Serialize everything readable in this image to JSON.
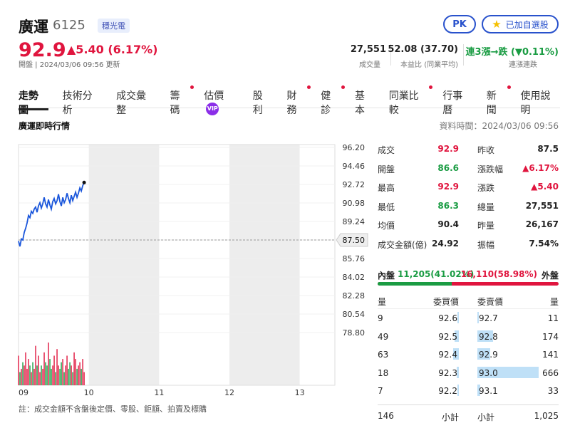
{
  "header": {
    "name": "廣運",
    "code": "6125",
    "tag": "穩光電",
    "pk_label": "PK",
    "fav_label": "已加自選股",
    "price": "92.9",
    "change": "▲5.40 (6.17%)",
    "status": "開盤 | 2024/03/06 09:56 更新"
  },
  "summary": [
    {
      "value": "27,551",
      "label": "成交量"
    },
    {
      "value": "52.08 (37.70)",
      "label": "本益比 (同業平均)"
    },
    {
      "value": "連3漲→跌 (▼0.11%)",
      "label": "連漲連跌"
    }
  ],
  "tabs": [
    {
      "label": "走勢圖",
      "active": true,
      "dot": false,
      "vip": false
    },
    {
      "label": "技術分析",
      "active": false,
      "dot": false,
      "vip": false
    },
    {
      "label": "成交彙整",
      "active": false,
      "dot": false,
      "vip": false
    },
    {
      "label": "籌碼",
      "active": false,
      "dot": true,
      "vip": false
    },
    {
      "label": "估價",
      "active": false,
      "dot": false,
      "vip": true
    },
    {
      "label": "股利",
      "active": false,
      "dot": false,
      "vip": false
    },
    {
      "label": "財務",
      "active": false,
      "dot": true,
      "vip": false
    },
    {
      "label": "健診",
      "active": false,
      "dot": true,
      "vip": false
    },
    {
      "label": "基本",
      "active": false,
      "dot": false,
      "vip": false
    },
    {
      "label": "同業比較",
      "active": false,
      "dot": true,
      "vip": false
    },
    {
      "label": "行事曆",
      "active": false,
      "dot": false,
      "vip": false
    },
    {
      "label": "新聞",
      "active": false,
      "dot": true,
      "vip": false
    },
    {
      "label": "使用說明",
      "active": false,
      "dot": false,
      "vip": false
    }
  ],
  "section_title": "廣運即時行情",
  "data_time": "資料時間：2024/03/06 09:56",
  "vip_label": "VIP",
  "chart_data": {
    "type": "line",
    "x_ticks": [
      "09",
      "10",
      "11",
      "12",
      "13"
    ],
    "y_ticks": [
      "96.20",
      "94.46",
      "92.72",
      "90.98",
      "89.24",
      "87.50",
      "85.76",
      "84.02",
      "82.28",
      "80.54",
      "78.80"
    ],
    "ylim": [
      78.8,
      96.2
    ],
    "reference_price": "87.50",
    "series": [
      {
        "values": [
          87.4,
          86.9,
          87.6,
          87.5,
          88.2,
          88.6,
          89.1,
          89.8,
          89.6,
          90.2,
          90.0,
          90.4,
          90.6,
          90.1,
          90.7,
          91.0,
          90.5,
          90.9,
          91.5,
          90.9,
          90.6,
          91.3,
          90.8,
          90.4,
          91.1,
          91.4,
          90.9,
          91.2,
          91.8,
          91.1,
          90.7,
          91.5,
          91.0,
          91.3,
          91.9,
          91.4,
          91.0,
          91.7,
          91.2,
          91.6,
          92.0,
          91.5,
          91.9,
          92.4,
          92.1,
          92.6,
          92.9
        ]
      }
    ],
    "volume": [
      9,
      4,
      5,
      7,
      6,
      10,
      5,
      8,
      6,
      4,
      7,
      5,
      12,
      6,
      9,
      4,
      6,
      5,
      10,
      7,
      6,
      13,
      8,
      5,
      6,
      9,
      4,
      11,
      6,
      5,
      7,
      8,
      4,
      6,
      9,
      5,
      7,
      6,
      4,
      10,
      8,
      5,
      6,
      7,
      5,
      8,
      4
    ]
  },
  "quote_table": [
    {
      "l1": "成交",
      "v1": "92.9",
      "c1": "red",
      "l2": "昨收",
      "v2": "87.5",
      "c2": "dark"
    },
    {
      "l1": "開盤",
      "v1": "86.6",
      "c1": "green",
      "l2": "漲跌幅",
      "v2": "▲6.17%",
      "c2": "red"
    },
    {
      "l1": "最高",
      "v1": "92.9",
      "c1": "red",
      "l2": "漲跌",
      "v2": "▲5.40",
      "c2": "red"
    },
    {
      "l1": "最低",
      "v1": "86.3",
      "c1": "green",
      "l2": "總量",
      "v2": "27,551",
      "c2": "dark"
    },
    {
      "l1": "均價",
      "v1": "90.4",
      "c1": "dark",
      "l2": "昨量",
      "v2": "26,167",
      "c2": "dark"
    },
    {
      "l1": "成交金額(億)",
      "v1": "24.92",
      "c1": "dark",
      "l2": "振幅",
      "v2": "7.54%",
      "c2": "dark"
    }
  ],
  "inout": {
    "in_label": "內盤",
    "in_value": "11,205(41.02%)",
    "out_value": "16,110(58.98%)",
    "out_label": "外盤",
    "in_ratio": 0.4102
  },
  "orderbook": {
    "headers": [
      "量",
      "委買價",
      "委賣價",
      "量"
    ],
    "rows": [
      {
        "bq": "9",
        "bp": "92.6",
        "ap": "92.7",
        "aq": "11",
        "bfill": 0.01,
        "afill": 0.02
      },
      {
        "bq": "49",
        "bp": "92.5",
        "ap": "92.8",
        "aq": "174",
        "bfill": 0.07,
        "afill": 0.26
      },
      {
        "bq": "63",
        "bp": "92.4",
        "ap": "92.9",
        "aq": "141",
        "bfill": 0.09,
        "afill": 0.21
      },
      {
        "bq": "18",
        "bp": "92.3",
        "ap": "93.0",
        "aq": "666",
        "bfill": 0.03,
        "afill": 1.0
      },
      {
        "bq": "7",
        "bp": "92.2",
        "ap": "93.1",
        "aq": "33",
        "bfill": 0.01,
        "afill": 0.05
      }
    ],
    "total_bid": "146",
    "subtotal_label": "小計",
    "total_ask": "1,025"
  },
  "footnote": "註：成交金額不含盤後定價、零股、鉅額、拍賣及標購",
  "colors": {
    "up": "#e0153e",
    "down": "#1a9c43",
    "line": "#1a56db",
    "accent": "#2952cc"
  }
}
